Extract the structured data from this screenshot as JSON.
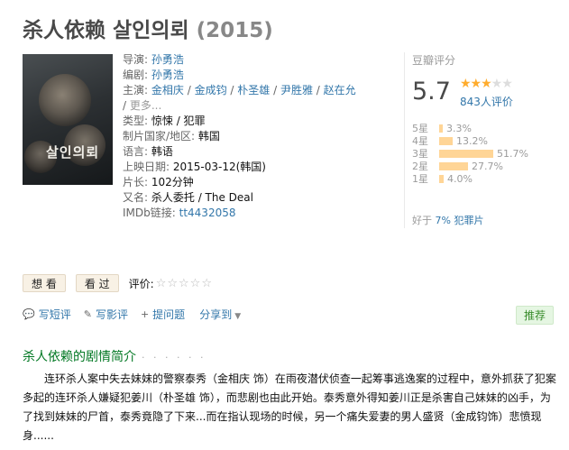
{
  "movie": {
    "title": "杀人依赖 살인의뢰",
    "year": "(2015)",
    "poster_title": "살인의뢰"
  },
  "info": {
    "director_label": "导演:",
    "director": "孙勇浩",
    "writer_label": "编剧:",
    "writer": "孙勇浩",
    "cast_label": "主演:",
    "cast": [
      "金相庆",
      "金成钧",
      "朴圣雄",
      "尹胜雅",
      "赵在允"
    ],
    "more": "更多...",
    "genre_label": "类型:",
    "genre": "惊悚 / 犯罪",
    "country_label": "制片国家/地区:",
    "country": "韩国",
    "language_label": "语言:",
    "language": "韩语",
    "release_label": "上映日期:",
    "release": "2015-03-12(韩国)",
    "runtime_label": "片长:",
    "runtime": "102分钟",
    "aka_label": "又名:",
    "aka": "杀人委托 / The Deal",
    "imdb_label": "IMDb链接:",
    "imdb": "tt4432058"
  },
  "rating": {
    "title": "豆瓣评分",
    "score": "5.7",
    "stars_on": 3,
    "votes": "843人评价",
    "distribution": [
      {
        "label": "5星",
        "pct": "3.3%",
        "value": 3.3
      },
      {
        "label": "4星",
        "pct": "13.2%",
        "value": 13.2
      },
      {
        "label": "3星",
        "pct": "51.7%",
        "value": 51.7
      },
      {
        "label": "2星",
        "pct": "27.7%",
        "value": 27.7
      },
      {
        "label": "1星",
        "pct": "4.0%",
        "value": 4.0
      }
    ],
    "better_prefix": "好于",
    "better_link": "7% 犯罪片"
  },
  "buttons": {
    "want": "想 看",
    "seen": "看 过",
    "rate_label": "评价:"
  },
  "actions": {
    "short_review": "写短评",
    "review": "写影评",
    "question": "提问题",
    "share": "分享到",
    "recommend": "推荐"
  },
  "summary": {
    "title": "杀人依赖的剧情简介",
    "dots": "· · · · · ·",
    "text": "连环杀人案中失去妹妹的警察泰秀（金相庆 饰）在雨夜潜伏侦查一起筹事逃逸案的过程中，意外抓获了犯案多起的连环杀人嫌疑犯姜川（朴圣雄 饰），而悲剧也由此开始。泰秀意外得知姜川正是杀害自己妹妹的凶手，为了找到妹妹的尸首，泰秀竟隐了下来...而在指认现场的时候，另一个痛失爱妻的男人盛贤（金成钧饰）悲愤现身......"
  }
}
